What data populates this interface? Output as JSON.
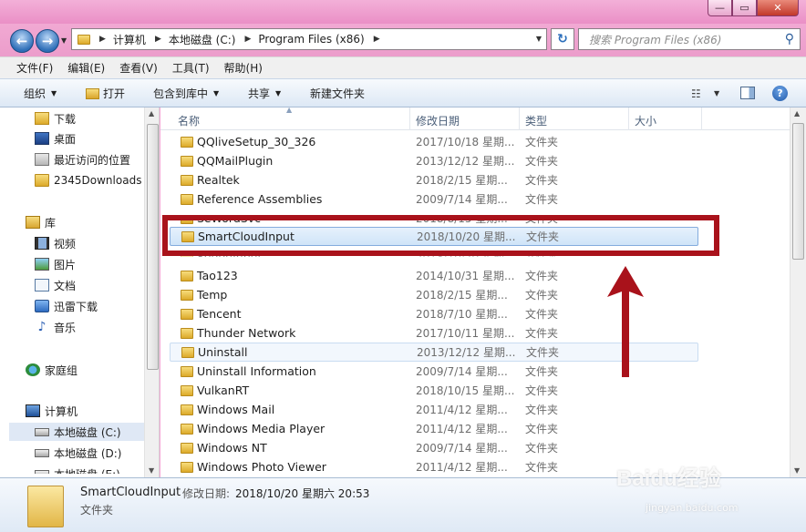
{
  "address": {
    "crumbs": [
      "计算机",
      "本地磁盘 (C:)",
      "Program Files (x86)"
    ],
    "search_placeholder": "搜索 Program Files (x86)"
  },
  "menu": [
    "文件(F)",
    "编辑(E)",
    "查看(V)",
    "工具(T)",
    "帮助(H)"
  ],
  "toolbar": {
    "organize": "组织",
    "open": "打开",
    "include": "包含到库中",
    "share": "共享",
    "new_folder": "新建文件夹"
  },
  "nav": {
    "items": [
      {
        "label": "下载",
        "icon": "download-folder-icon"
      },
      {
        "label": "桌面",
        "icon": "desktop-icon"
      },
      {
        "label": "最近访问的位置",
        "icon": "recent-places-icon"
      },
      {
        "label": "2345Downloads",
        "icon": "folder-icon"
      },
      {
        "label": "库",
        "icon": "library-icon"
      },
      {
        "label": "视频",
        "icon": "video-icon"
      },
      {
        "label": "图片",
        "icon": "picture-icon"
      },
      {
        "label": "文档",
        "icon": "document-icon"
      },
      {
        "label": "迅雷下载",
        "icon": "thunder-icon"
      },
      {
        "label": "音乐",
        "icon": "music-icon"
      },
      {
        "label": "家庭组",
        "icon": "homegroup-icon"
      },
      {
        "label": "计算机",
        "icon": "computer-icon"
      },
      {
        "label": "本地磁盘 (C:)",
        "icon": "drive-icon"
      },
      {
        "label": "本地磁盘 (D:)",
        "icon": "drive-icon"
      },
      {
        "label": "本地磁盘 (E:)",
        "icon": "drive-icon"
      }
    ]
  },
  "columns": {
    "name": "名称",
    "date": "修改日期",
    "type": "类型",
    "size": "大小"
  },
  "files": [
    {
      "name": "QQliveSetup_30_326",
      "date": "2017/10/18 星期...",
      "type": "文件夹"
    },
    {
      "name": "QQMailPlugin",
      "date": "2013/12/12 星期...",
      "type": "文件夹"
    },
    {
      "name": "Realtek",
      "date": "2018/2/15 星期...",
      "type": "文件夹"
    },
    {
      "name": "Reference Assemblies",
      "date": "2009/7/14 星期...",
      "type": "文件夹"
    },
    {
      "name": "SeWordSvc",
      "date": "2018/8/15 星期...",
      "type": "文件夹"
    },
    {
      "name": "SmartCloudInput",
      "date": "2018/10/20 星期...",
      "type": "文件夹"
    },
    {
      "name": "SogouInput",
      "date": "2018/10/20 星期...",
      "type": "文件夹"
    },
    {
      "name": "Tao123",
      "date": "2014/10/31 星期...",
      "type": "文件夹"
    },
    {
      "name": "Temp",
      "date": "2018/2/15 星期...",
      "type": "文件夹"
    },
    {
      "name": "Tencent",
      "date": "2018/7/10 星期...",
      "type": "文件夹"
    },
    {
      "name": "Thunder Network",
      "date": "2017/10/11 星期...",
      "type": "文件夹"
    },
    {
      "name": "Uninstall",
      "date": "2013/12/12 星期...",
      "type": "文件夹"
    },
    {
      "name": "Uninstall Information",
      "date": "2009/7/14 星期...",
      "type": "文件夹"
    },
    {
      "name": "VulkanRT",
      "date": "2018/10/15 星期...",
      "type": "文件夹"
    },
    {
      "name": "Windows Mail",
      "date": "2011/4/12 星期...",
      "type": "文件夹"
    },
    {
      "name": "Windows Media Player",
      "date": "2011/4/12 星期...",
      "type": "文件夹"
    },
    {
      "name": "Windows NT",
      "date": "2009/7/14 星期...",
      "type": "文件夹"
    },
    {
      "name": "Windows Photo Viewer",
      "date": "2011/4/12 星期...",
      "type": "文件夹"
    }
  ],
  "details": {
    "name": "SmartCloudInput",
    "date_label": "修改日期:",
    "date_value": "2018/10/20 星期六 20:53",
    "type": "文件夹"
  },
  "watermark": {
    "brand": "Baidu经验",
    "url": "jingyan.baidu.com"
  },
  "colors": {
    "annotation": "#a9121b",
    "title_bar": "#ea8fc6",
    "selection": "#cfe4f8"
  }
}
